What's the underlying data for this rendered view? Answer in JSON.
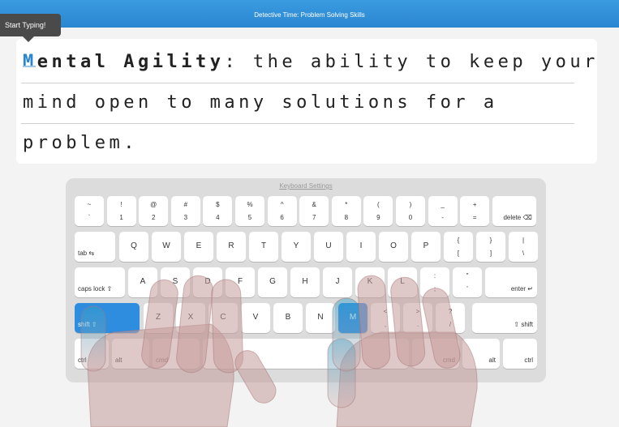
{
  "header": {
    "title": "Detective Time: Problem Solving Skills"
  },
  "tooltip": {
    "text": "Start Typing!"
  },
  "prompt": {
    "term_first": "M",
    "term_rest": "ental Agility",
    "line1_rest": ": the ability to keep your",
    "line2": "mind open to many solutions for a",
    "line3": "problem."
  },
  "keyboard": {
    "settings_link": "Keyboard Settings",
    "row1": [
      {
        "top": "~",
        "bottom": "`"
      },
      {
        "top": "!",
        "bottom": "1"
      },
      {
        "top": "@",
        "bottom": "2"
      },
      {
        "top": "#",
        "bottom": "3"
      },
      {
        "top": "$",
        "bottom": "4"
      },
      {
        "top": "%",
        "bottom": "5"
      },
      {
        "top": "^",
        "bottom": "6"
      },
      {
        "top": "&",
        "bottom": "7"
      },
      {
        "top": "*",
        "bottom": "8"
      },
      {
        "top": "(",
        "bottom": "9"
      },
      {
        "top": ")",
        "bottom": "0"
      },
      {
        "top": "_",
        "bottom": "-"
      },
      {
        "top": "+",
        "bottom": "="
      }
    ],
    "delete": "delete ⌫",
    "tab": "tab ⇆",
    "row2": [
      "Q",
      "W",
      "E",
      "R",
      "T",
      "Y",
      "U",
      "I",
      "O",
      "P"
    ],
    "row2_sym": [
      {
        "top": "{",
        "bottom": "["
      },
      {
        "top": "}",
        "bottom": "]"
      },
      {
        "top": "|",
        "bottom": "\\"
      }
    ],
    "caps": "caps lock ⇧",
    "row3": [
      "A",
      "S",
      "D",
      "F",
      "G",
      "H",
      "J",
      "K",
      "L"
    ],
    "row3_sym": [
      {
        "top": ":",
        "bottom": ";"
      },
      {
        "top": "\"",
        "bottom": "'"
      }
    ],
    "enter": "enter ↵",
    "shift_left": "shift ⇧",
    "row4": [
      "Z",
      "X",
      "C",
      "V",
      "B",
      "N",
      "M"
    ],
    "row4_sym": [
      {
        "top": "<",
        "bottom": ","
      },
      {
        "top": ">",
        "bottom": "."
      },
      {
        "top": "?",
        "bottom": "/"
      }
    ],
    "shift_right": "⇧ shift",
    "ctrl": "ctrl",
    "alt": "alt",
    "cmd": "cmd",
    "highlight_color": "#2f8de0"
  }
}
